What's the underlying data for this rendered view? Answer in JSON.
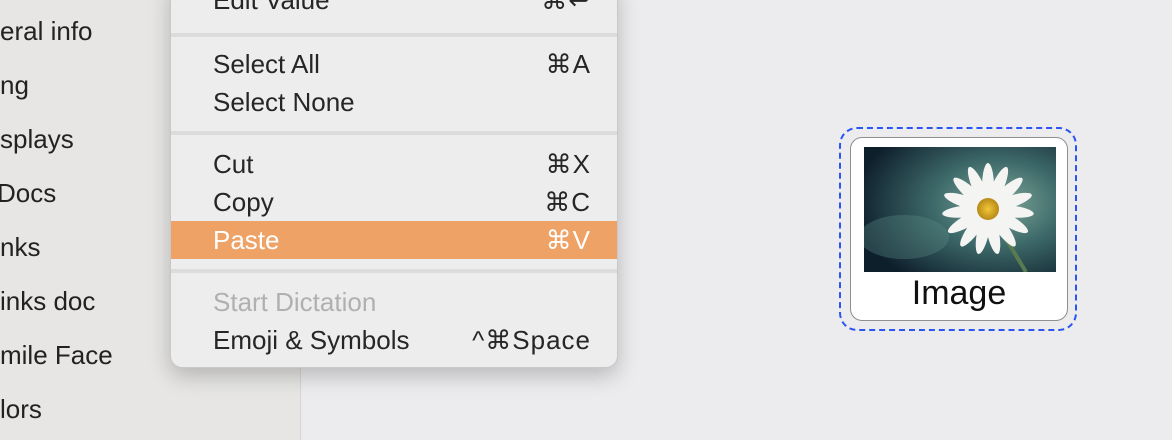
{
  "sidebar": {
    "items": [
      {
        "label": "eral info"
      },
      {
        "label": "ng"
      },
      {
        "label": "splays"
      },
      {
        "label": "Docs"
      },
      {
        "label": "nks"
      },
      {
        "label": "inks doc"
      },
      {
        "label": "mile Face"
      },
      {
        "label": "lors"
      }
    ]
  },
  "menu": {
    "items": [
      {
        "label": "Edit Value",
        "shortcut": "⌘↩"
      },
      {
        "label": "Select All",
        "shortcut": "⌘A"
      },
      {
        "label": "Select None",
        "shortcut": ""
      },
      {
        "label": "Cut",
        "shortcut": "⌘X"
      },
      {
        "label": "Copy",
        "shortcut": "⌘C"
      },
      {
        "label": "Paste",
        "shortcut": "⌘V",
        "highlighted": true
      },
      {
        "label": "Start Dictation",
        "shortcut": "",
        "disabled": true
      },
      {
        "label": "Emoji & Symbols",
        "shortcut": "^⌘Space"
      }
    ]
  },
  "image_card": {
    "label": "Image",
    "image_icon": "daisy-flower-photo"
  },
  "colors": {
    "highlight": "#eea265",
    "selection_outline": "#2a55f2",
    "disabled_text": "#b0b0b0"
  }
}
